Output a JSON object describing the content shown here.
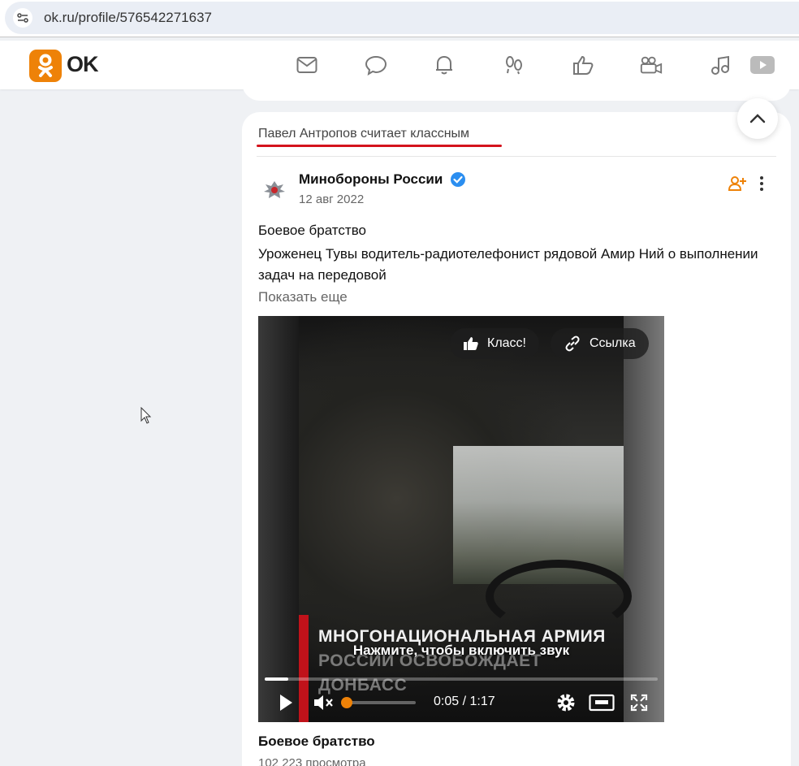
{
  "browser": {
    "url": "ok.ru/profile/576542271637"
  },
  "header": {
    "logo_text": "OK",
    "brand_color": "#ee8208",
    "nav_icons": [
      "mail-icon",
      "chat-icon",
      "bell-icon",
      "guests-icon",
      "like-icon",
      "video-camera-icon",
      "music-icon",
      "video-icon"
    ]
  },
  "feed": {
    "activity_text": "Павел Антропов считает классным",
    "post": {
      "group_name": "Минобороны России",
      "date": "12 авг 2022",
      "title": "Боевое братство",
      "text": "Уроженец Тувы водитель-радиотелефонист рядовой Амир Ний о выполнении задач на передовой",
      "show_more": "Показать еще",
      "video": {
        "class_button": "Класс!",
        "link_button": "Ссылка",
        "caption_line1": "МНОГОНАЦИОНАЛЬНАЯ АРМИЯ",
        "caption_line2": "РОССИИ ОСВОБОЖДАЕТ",
        "caption_line3": "ДОНБАСС",
        "unmute_hint": "Нажмите, чтобы включить звук",
        "current_time": "0:05",
        "duration": "1:17",
        "time_display": "0:05 / 1:17",
        "progress_percent": 6,
        "volume_percent": 0
      },
      "video_title": "Боевое братство",
      "views": "102 223 просмотра"
    }
  }
}
